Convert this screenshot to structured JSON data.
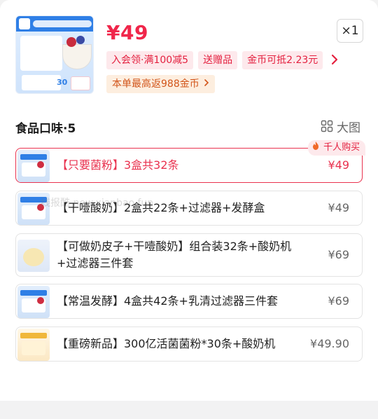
{
  "product": {
    "price": "¥49",
    "quantity": "×1",
    "promo_tags": [
      "入会领·满100减5",
      "送赠品",
      "金币可抵2.23元"
    ],
    "cashback": "本单最高返988金币",
    "thumbnail_badge": "30"
  },
  "section": {
    "title": "食品口味·5",
    "view_label": "大图"
  },
  "hot_badge": "千人购买",
  "options": [
    {
      "label": "【只要菌粉】3盒共32条",
      "price": "¥49",
      "selected": true
    },
    {
      "label": "【干噎酸奶】2盒共22条+过滤器+发酵盒",
      "price": "¥49",
      "selected": false
    },
    {
      "label": "【可做奶皮子+干噎酸奶】组合装32条+酸奶机",
      "label2": "+过滤器三件套",
      "price": "¥69",
      "selected": false
    },
    {
      "label": "【常温发酵】4盒共42条+乳清过滤器三件套",
      "price": "¥69",
      "selected": false
    },
    {
      "label": "【重磅新品】300亿活菌菌粉*30条+酸奶机",
      "price": "¥49.90",
      "selected": false
    }
  ],
  "watermark": "线报酷 new.xianbao.fun",
  "colors": {
    "accent": "#f0264a",
    "tag_bg": "#fde9ec",
    "cashback_bg": "#fdeedf",
    "cashback_text": "#d2551a"
  },
  "icons": {
    "close": "close-icon",
    "grid": "grid-icon",
    "chevron": "chevron-right-icon",
    "flame": "flame-icon"
  }
}
